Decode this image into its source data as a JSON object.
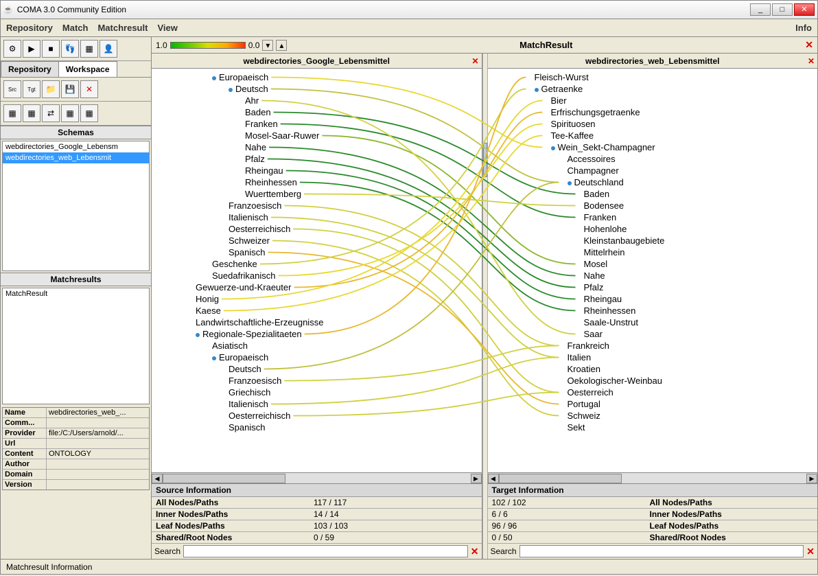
{
  "window": {
    "title": "COMA 3.0 Community Edition"
  },
  "menu": {
    "repository": "Repository",
    "match": "Match",
    "matchresult": "Matchresult",
    "view": "View",
    "info": "Info"
  },
  "tabs": {
    "repository": "Repository",
    "workspace": "Workspace"
  },
  "sections": {
    "schemas": "Schemas",
    "matchresults": "Matchresults"
  },
  "schemas": {
    "item0": "webdirectories_Google_Lebensm",
    "item1": "webdirectories_web_Lebensmit"
  },
  "matchresults": {
    "item0": "MatchResult"
  },
  "props": {
    "name_k": "Name",
    "name_v": "webdirectories_web_...",
    "comm_k": "Comm...",
    "comm_v": "",
    "provider_k": "Provider",
    "provider_v": "file:/C:/Users/arnold/...",
    "url_k": "Url",
    "url_v": "",
    "content_k": "Content",
    "content_v": "ONTOLOGY",
    "author_k": "Author",
    "author_v": "",
    "domain_k": "Domain",
    "domain_v": "",
    "version_k": "Version",
    "version_v": ""
  },
  "gradient": {
    "hi": "1.0",
    "lo": "0.0"
  },
  "matchresult_label": "MatchResult",
  "leftpane": {
    "header": "webdirectories_Google_Lebensmittel",
    "nodes": [
      {
        "d": 0,
        "h": "o",
        "t": "Europaeisch"
      },
      {
        "d": 1,
        "h": "o",
        "t": "Deutsch"
      },
      {
        "d": 2,
        "h": "-",
        "t": "Ahr"
      },
      {
        "d": 2,
        "h": "-",
        "t": "Baden"
      },
      {
        "d": 2,
        "h": "-",
        "t": "Franken"
      },
      {
        "d": 2,
        "h": "-",
        "t": "Mosel-Saar-Ruwer"
      },
      {
        "d": 2,
        "h": "-",
        "t": "Nahe"
      },
      {
        "d": 2,
        "h": "-",
        "t": "Pfalz"
      },
      {
        "d": 2,
        "h": "-",
        "t": "Rheingau"
      },
      {
        "d": 2,
        "h": "-",
        "t": "Rheinhessen"
      },
      {
        "d": 2,
        "h": "-",
        "t": "Wuerttemberg"
      },
      {
        "d": 1,
        "h": "-",
        "t": "Franzoesisch"
      },
      {
        "d": 1,
        "h": "-",
        "t": "Italienisch"
      },
      {
        "d": 1,
        "h": "-",
        "t": "Oesterreichisch"
      },
      {
        "d": 1,
        "h": "-",
        "t": "Schweizer"
      },
      {
        "d": 1,
        "h": "-",
        "t": "Spanisch"
      },
      {
        "d": 0,
        "h": "-",
        "t": "Geschenke"
      },
      {
        "d": 0,
        "h": "-",
        "t": "Suedafrikanisch"
      },
      {
        "d": -1,
        "h": "-",
        "t": "Gewuerze-und-Kraeuter"
      },
      {
        "d": -1,
        "h": "-",
        "t": "Honig"
      },
      {
        "d": -1,
        "h": "-",
        "t": "Kaese"
      },
      {
        "d": -1,
        "h": "-",
        "t": "Landwirtschaftliche-Erzeugnisse"
      },
      {
        "d": -1,
        "h": "o",
        "t": "Regionale-Spezialitaeten"
      },
      {
        "d": 0,
        "h": "-",
        "t": "Asiatisch"
      },
      {
        "d": 0,
        "h": "o",
        "t": "Europaeisch"
      },
      {
        "d": 1,
        "h": "-",
        "t": "Deutsch"
      },
      {
        "d": 1,
        "h": "-",
        "t": "Franzoesisch"
      },
      {
        "d": 1,
        "h": "-",
        "t": "Griechisch"
      },
      {
        "d": 1,
        "h": "-",
        "t": "Italienisch"
      },
      {
        "d": 1,
        "h": "-",
        "t": "Oesterreichisch"
      },
      {
        "d": 1,
        "h": "-",
        "t": "Spanisch"
      }
    ]
  },
  "rightpane": {
    "header": "webdirectories_web_Lebensmittel",
    "nodes": [
      {
        "d": 0,
        "h": "-",
        "t": "Fleisch-Wurst"
      },
      {
        "d": 0,
        "h": "o",
        "t": "Getraenke"
      },
      {
        "d": 1,
        "h": "-",
        "t": "Bier"
      },
      {
        "d": 1,
        "h": "-",
        "t": "Erfrischungsgetraenke"
      },
      {
        "d": 1,
        "h": "-",
        "t": "Spirituosen"
      },
      {
        "d": 1,
        "h": "-",
        "t": "Tee-Kaffee"
      },
      {
        "d": 1,
        "h": "o",
        "t": "Wein_Sekt-Champagner"
      },
      {
        "d": 2,
        "h": "-",
        "t": "Accessoires"
      },
      {
        "d": 2,
        "h": "-",
        "t": "Champagner"
      },
      {
        "d": 2,
        "h": "o",
        "t": "Deutschland"
      },
      {
        "d": 3,
        "h": "-",
        "t": "Baden"
      },
      {
        "d": 3,
        "h": "-",
        "t": "Bodensee"
      },
      {
        "d": 3,
        "h": "-",
        "t": "Franken"
      },
      {
        "d": 3,
        "h": "-",
        "t": "Hohenlohe"
      },
      {
        "d": 3,
        "h": "-",
        "t": "Kleinstanbaugebiete"
      },
      {
        "d": 3,
        "h": "-",
        "t": "Mittelrhein"
      },
      {
        "d": 3,
        "h": "-",
        "t": "Mosel"
      },
      {
        "d": 3,
        "h": "-",
        "t": "Nahe"
      },
      {
        "d": 3,
        "h": "-",
        "t": "Pfalz"
      },
      {
        "d": 3,
        "h": "-",
        "t": "Rheingau"
      },
      {
        "d": 3,
        "h": "-",
        "t": "Rheinhessen"
      },
      {
        "d": 3,
        "h": "-",
        "t": "Saale-Unstrut"
      },
      {
        "d": 3,
        "h": "-",
        "t": "Saar"
      },
      {
        "d": 2,
        "h": "-",
        "t": "Frankreich"
      },
      {
        "d": 2,
        "h": "-",
        "t": "Italien"
      },
      {
        "d": 2,
        "h": "-",
        "t": "Kroatien"
      },
      {
        "d": 2,
        "h": "-",
        "t": "Oekologischer-Weinbau"
      },
      {
        "d": 2,
        "h": "-",
        "t": "Oesterreich"
      },
      {
        "d": 2,
        "h": "-",
        "t": "Portugal"
      },
      {
        "d": 2,
        "h": "-",
        "t": "Schweiz"
      },
      {
        "d": 2,
        "h": "-",
        "t": "Sekt"
      }
    ]
  },
  "source_info": {
    "title": "Source Information",
    "rows": [
      {
        "k": "All Nodes/Paths",
        "v": "117 / 117"
      },
      {
        "k": "Inner Nodes/Paths",
        "v": "14 / 14"
      },
      {
        "k": "Leaf Nodes/Paths",
        "v": "103 / 103"
      },
      {
        "k": "Shared/Root Nodes",
        "v": "0 / 59"
      }
    ],
    "search_label": "Search"
  },
  "target_info": {
    "title": "Target Information",
    "rows": [
      {
        "k": "",
        "v": "102 / 102",
        "k2": "All Nodes/Paths"
      },
      {
        "k": "",
        "v": "6 / 6",
        "k2": "Inner Nodes/Paths"
      },
      {
        "k": "",
        "v": "96 / 96",
        "k2": "Leaf Nodes/Paths"
      },
      {
        "k": "",
        "v": "0 / 50",
        "k2": "Shared/Root Nodes"
      }
    ],
    "search_label": "Search"
  },
  "statusbar": "Matchresult Information",
  "links": [
    {
      "l": 3,
      "r": 10,
      "c": "#2a8a2a"
    },
    {
      "l": 4,
      "r": 12,
      "c": "#2a8a2a"
    },
    {
      "l": 5,
      "r": 16,
      "c": "#8ab82a"
    },
    {
      "l": 6,
      "r": 17,
      "c": "#2a8a2a"
    },
    {
      "l": 7,
      "r": 18,
      "c": "#2a8a2a"
    },
    {
      "l": 8,
      "r": 19,
      "c": "#2a8a2a"
    },
    {
      "l": 9,
      "r": 20,
      "c": "#2a8a2a"
    },
    {
      "l": 10,
      "r": 11,
      "c": "#d0d040"
    },
    {
      "l": 1,
      "r": 9,
      "c": "#c0c040"
    },
    {
      "l": 11,
      "r": 23,
      "c": "#d0d040"
    },
    {
      "l": 12,
      "r": 24,
      "c": "#d0d040"
    },
    {
      "l": 13,
      "r": 27,
      "c": "#d0d040"
    },
    {
      "l": 14,
      "r": 29,
      "c": "#d0d040"
    },
    {
      "l": 15,
      "r": 28,
      "c": "#e8b830"
    },
    {
      "l": 0,
      "r": 6,
      "c": "#e8d830"
    },
    {
      "l": 2,
      "r": 22,
      "c": "#d0d040"
    },
    {
      "l": 18,
      "r": 3,
      "c": "#e8b830"
    },
    {
      "l": 19,
      "r": 2,
      "c": "#e8d830"
    },
    {
      "l": 20,
      "r": 5,
      "c": "#e8d830"
    },
    {
      "l": 16,
      "r": 1,
      "c": "#d0d040"
    },
    {
      "l": 17,
      "r": 4,
      "c": "#e8d830"
    },
    {
      "l": 22,
      "r": 0,
      "c": "#e8b830"
    },
    {
      "l": 25,
      "r": 9,
      "c": "#c0c040"
    },
    {
      "l": 26,
      "r": 23,
      "c": "#d0d040"
    },
    {
      "l": 28,
      "r": 24,
      "c": "#d0d040"
    },
    {
      "l": 29,
      "r": 27,
      "c": "#d0d040"
    }
  ]
}
